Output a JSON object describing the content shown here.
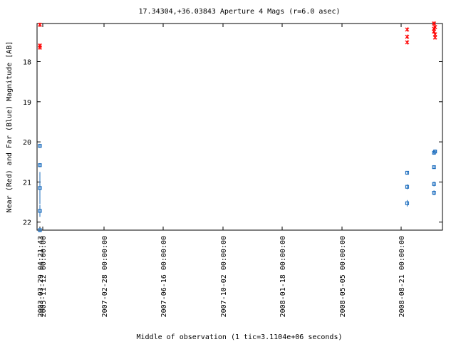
{
  "chart_data": {
    "type": "scatter",
    "title": "17.34304,+36.03843   Aperture 4 Mags (r=6.0 asec)",
    "xlabel": "Middle of observation (1 tic=3.1104e+06 seconds)",
    "ylabel": "Near (Red) and Far (Blue) Magnitude [AB]",
    "y_inverted": true,
    "ylim": [
      22.2,
      17.05
    ],
    "yticks": [
      "18",
      "19",
      "20",
      "21",
      "22"
    ],
    "xticks": [
      "2003-03-29 04:21:43",
      "2005-11-12 00:00:00",
      "2007-02-28 00:00:00",
      "2007-06-16 00:00:00",
      "2007-10-02 00:00:00",
      "2008-01-18 00:00:00",
      "2008-05-05 00:00:00",
      "2008-08-21 00:00:00"
    ],
    "grid": false,
    "series": [
      {
        "name": "Near",
        "color": "#ff0000",
        "marker": "x",
        "points": [
          {
            "x": "2003-03-29",
            "y": 17.08,
            "err": 0.0
          },
          {
            "x": "2003-03-29",
            "y": 17.6,
            "err": 0.0
          },
          {
            "x": "2003-03-29",
            "y": 17.65,
            "err": 0.0
          },
          {
            "x": "2008-09-01",
            "y": 17.2,
            "err": 0.0
          },
          {
            "x": "2008-09-01",
            "y": 17.38,
            "err": 0.0
          },
          {
            "x": "2008-09-01",
            "y": 17.52,
            "err": 0.0
          },
          {
            "x": "2008-10-20",
            "y": 17.05,
            "err": 0.0
          },
          {
            "x": "2008-10-20",
            "y": 17.18,
            "err": 0.0
          },
          {
            "x": "2008-10-20",
            "y": 17.25,
            "err": 0.0
          },
          {
            "x": "2008-10-22",
            "y": 17.14,
            "err": 0.0
          },
          {
            "x": "2008-10-22",
            "y": 17.32,
            "err": 0.0
          },
          {
            "x": "2008-10-22",
            "y": 17.4,
            "err": 0.0
          }
        ]
      },
      {
        "name": "Far",
        "color": "#1f6fbf",
        "marker": "square",
        "points": [
          {
            "x": "2003-03-29",
            "y": 20.1,
            "err": 0.05
          },
          {
            "x": "2003-03-29",
            "y": 20.58,
            "err": 0.05
          },
          {
            "x": "2003-03-29",
            "y": 21.15,
            "err": 0.4
          },
          {
            "x": "2003-03-29",
            "y": 21.72,
            "err": 0.15
          },
          {
            "x": "2003-03-29",
            "y": 22.2,
            "err": 0.05
          },
          {
            "x": "2008-09-01",
            "y": 20.77,
            "err": 0.04
          },
          {
            "x": "2008-09-01",
            "y": 21.12,
            "err": 0.06
          },
          {
            "x": "2008-09-01",
            "y": 21.53,
            "err": 0.08
          },
          {
            "x": "2008-10-20",
            "y": 20.27,
            "err": 0.05
          },
          {
            "x": "2008-10-20",
            "y": 20.63,
            "err": 0.04
          },
          {
            "x": "2008-10-20",
            "y": 21.05,
            "err": 0.06
          },
          {
            "x": "2008-10-20",
            "y": 21.27,
            "err": 0.06
          },
          {
            "x": "2008-10-22",
            "y": 20.24,
            "err": 0.05
          }
        ]
      }
    ]
  }
}
